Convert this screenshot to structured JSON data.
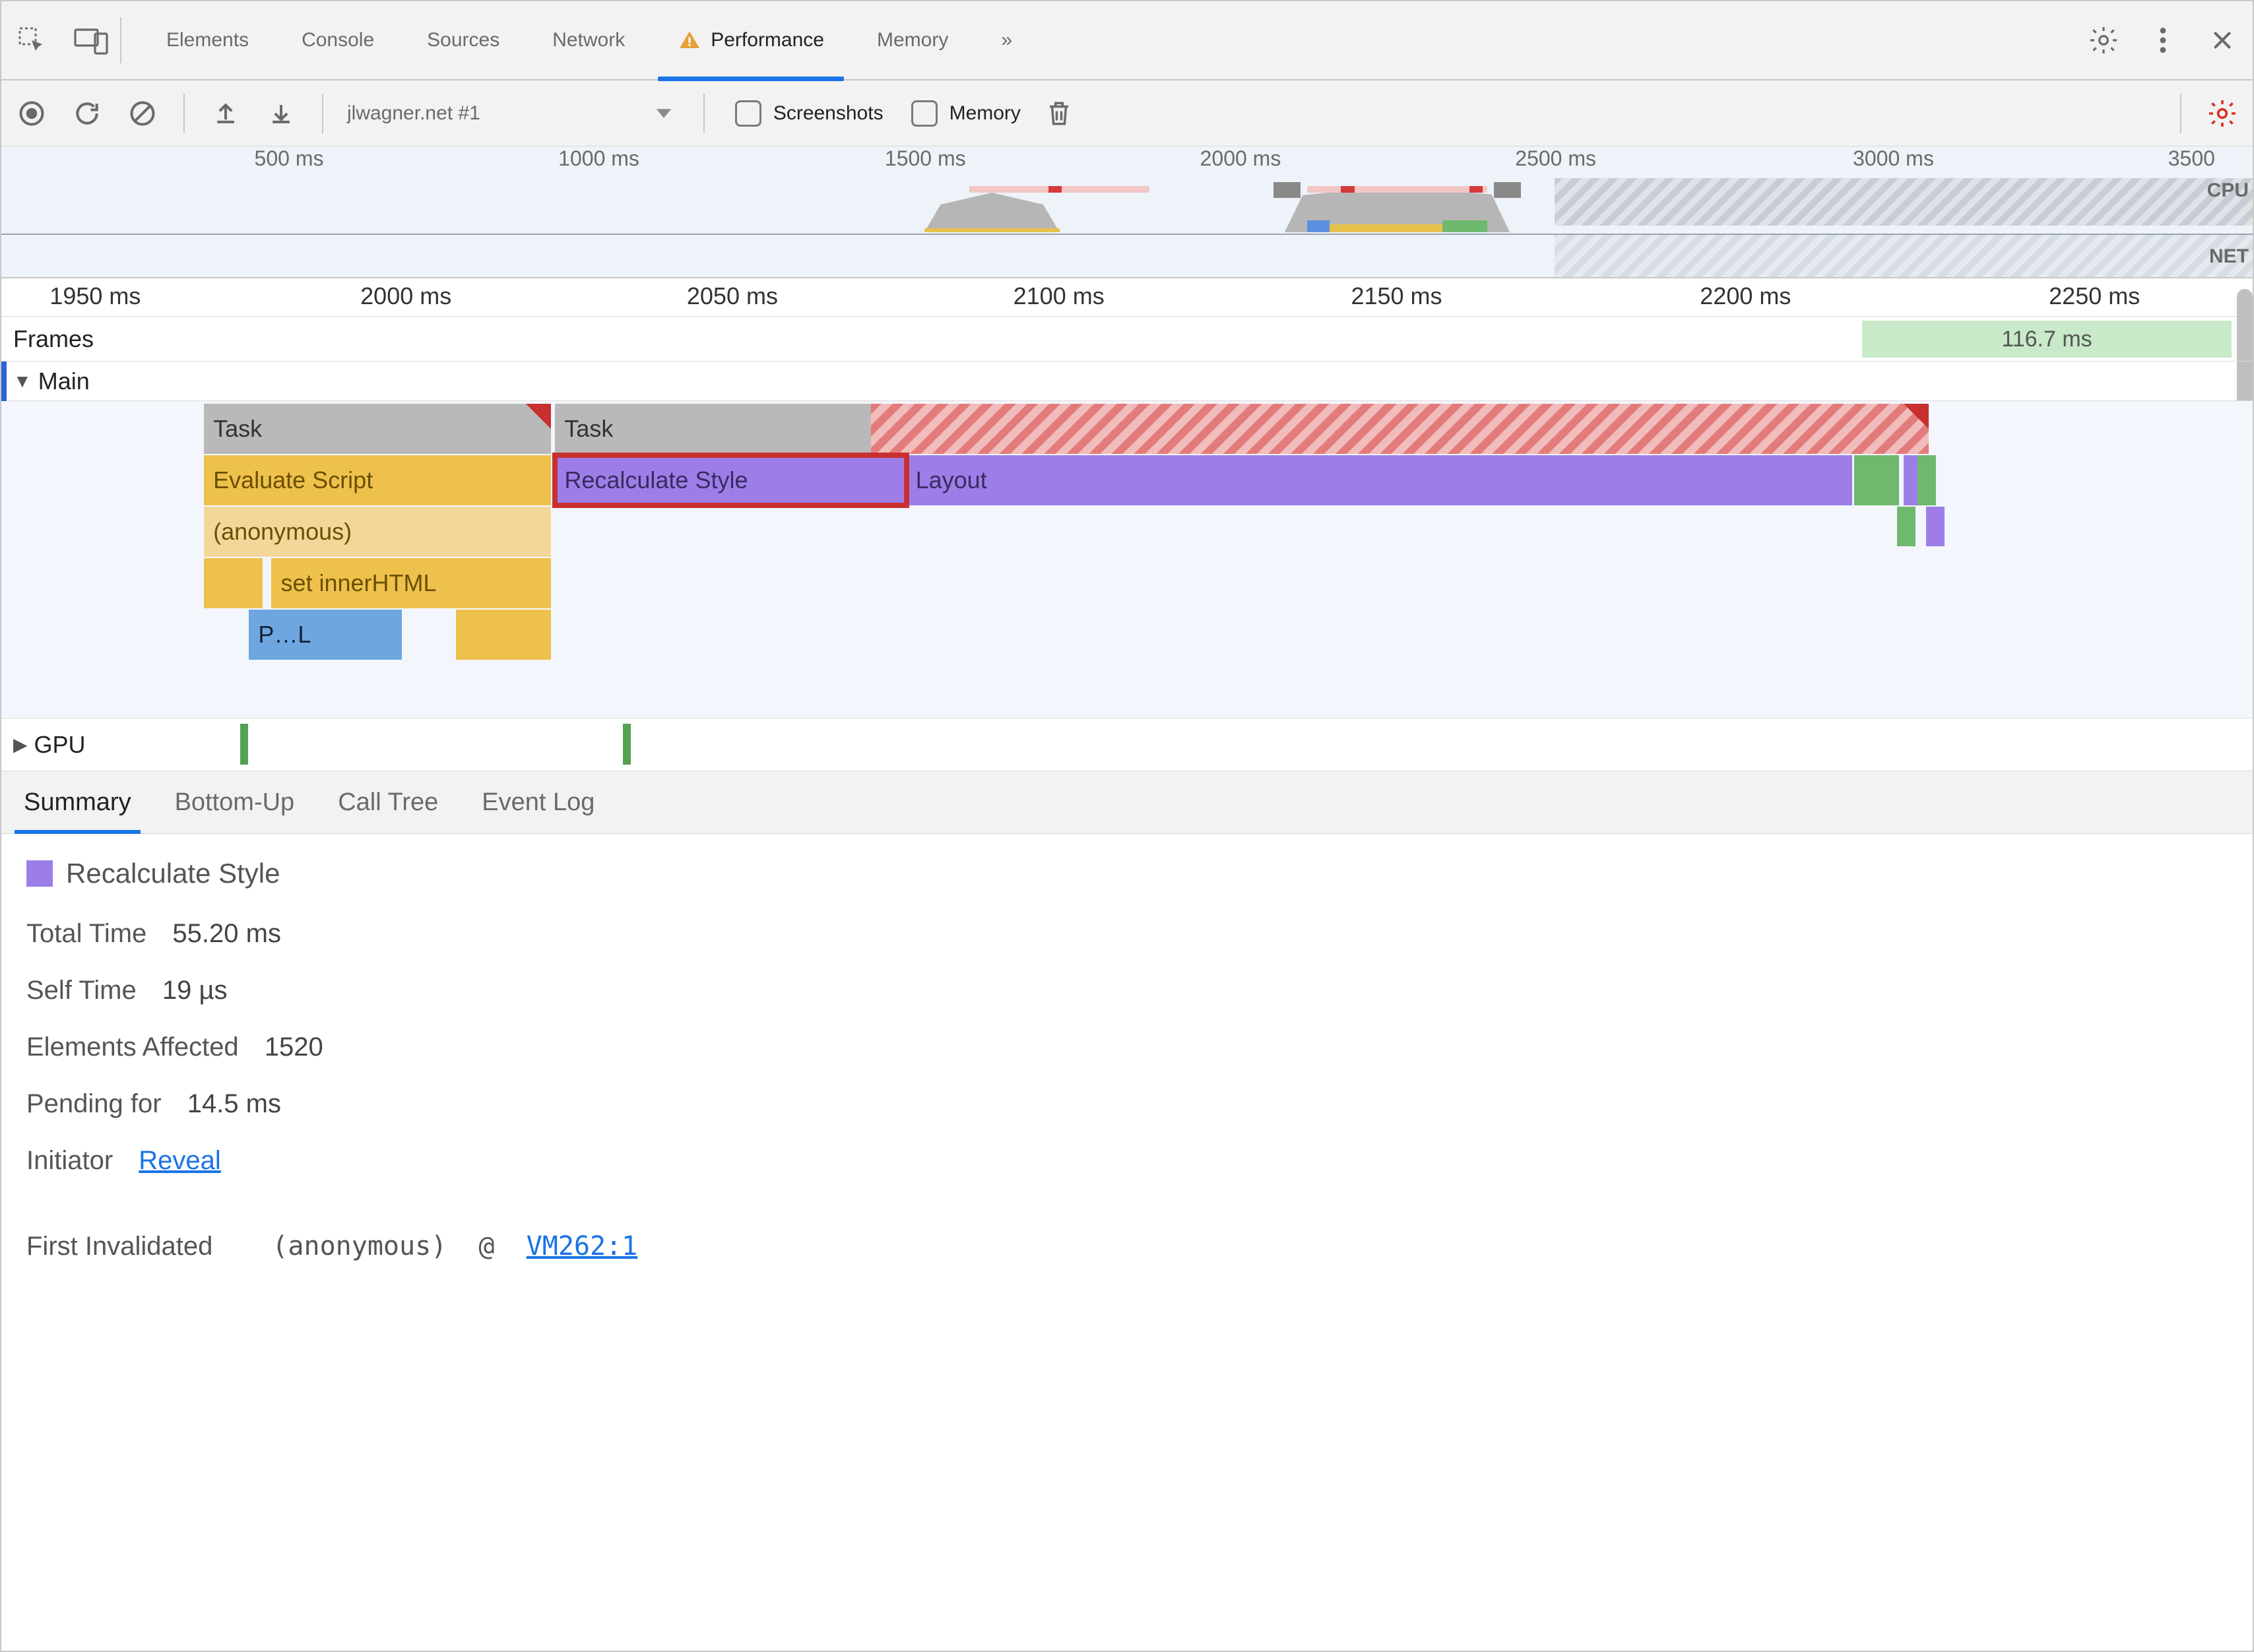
{
  "tabs": {
    "elements": "Elements",
    "console": "Console",
    "sources": "Sources",
    "network": "Network",
    "performance": "Performance",
    "memory": "Memory",
    "more": "»"
  },
  "toolbar": {
    "recording_name": "jlwagner.net #1",
    "screenshots_label": "Screenshots",
    "memory_label": "Memory"
  },
  "overview_ruler": {
    "ticks": [
      {
        "label": "500 ms",
        "pct": 13.0
      },
      {
        "label": "1000 ms",
        "pct": 26.5
      },
      {
        "label": "1500 ms",
        "pct": 41.0
      },
      {
        "label": "2000 ms",
        "pct": 55.0
      },
      {
        "label": "2500 ms",
        "pct": 69.0
      },
      {
        "label": "3000 ms",
        "pct": 84.0
      },
      {
        "label": "3500",
        "pct": 98.0
      }
    ],
    "cpu_label": "CPU",
    "net_label": "NET"
  },
  "detail_ruler": {
    "ticks": [
      {
        "label": "1950 ms",
        "pct": 4.2
      },
      {
        "label": "2000 ms",
        "pct": 18.0
      },
      {
        "label": "2050 ms",
        "pct": 32.5
      },
      {
        "label": "2100 ms",
        "pct": 47.0
      },
      {
        "label": "2150 ms",
        "pct": 62.0
      },
      {
        "label": "2200 ms",
        "pct": 77.5
      },
      {
        "label": "2250 ms",
        "pct": 93.0
      }
    ]
  },
  "tracks": {
    "frames_label": "Frames",
    "frames_value": "116.7 ms",
    "main_label": "Main",
    "gpu_label": "GPU"
  },
  "flame": {
    "row0": {
      "task1": "Task",
      "task2": "Task"
    },
    "row1": {
      "eval": "Evaluate Script",
      "recalc": "Recalculate Style",
      "layout": "Layout"
    },
    "row2": {
      "anon": "(anonymous)"
    },
    "row3": {
      "set_inner": "set innerHTML"
    },
    "row4": {
      "pl": "P…L"
    }
  },
  "bottom_tabs": {
    "summary": "Summary",
    "bottom_up": "Bottom-Up",
    "call_tree": "Call Tree",
    "event_log": "Event Log"
  },
  "summary": {
    "title": "Recalculate Style",
    "total_time_k": "Total Time",
    "total_time_v": "55.20 ms",
    "self_time_k": "Self Time",
    "self_time_v": "19 µs",
    "elements_k": "Elements Affected",
    "elements_v": "1520",
    "pending_k": "Pending for",
    "pending_v": "14.5 ms",
    "initiator_k": "Initiator",
    "initiator_link": "Reveal",
    "first_inv_k": "First Invalidated",
    "first_inv_fn": "(anonymous)",
    "first_inv_at": "@",
    "first_inv_loc": "VM262:1"
  }
}
